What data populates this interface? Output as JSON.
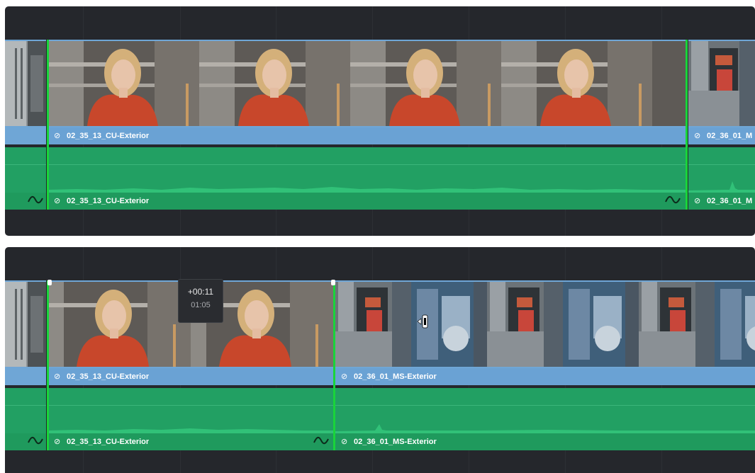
{
  "top_timeline": {
    "video_clips": [
      {
        "name": "prev-clip-video",
        "label": ""
      },
      {
        "name": "cu-exterior-video",
        "label": "02_35_13_CU-Exterior"
      },
      {
        "name": "ms-exterior-video",
        "label": "02_36_01_M"
      }
    ],
    "audio_clips": [
      {
        "name": "prev-clip-audio",
        "label": ""
      },
      {
        "name": "cu-exterior-audio",
        "label": "02_35_13_CU-Exterior"
      },
      {
        "name": "ms-exterior-audio",
        "label": "02_36_01_M"
      }
    ]
  },
  "bottom_timeline": {
    "video_clips": [
      {
        "name": "prev-clip-video",
        "label": ""
      },
      {
        "name": "cu-exterior-video",
        "label": "02_35_13_CU-Exterior"
      },
      {
        "name": "ms-exterior-video",
        "label": "02_36_01_MS-Exterior"
      }
    ],
    "audio_clips": [
      {
        "name": "prev-clip-audio",
        "label": ""
      },
      {
        "name": "cu-exterior-audio",
        "label": "02_35_13_CU-Exterior"
      },
      {
        "name": "ms-exterior-audio",
        "label": "02_36_01_MS-Exterior"
      }
    ],
    "trim_tooltip": {
      "offset": "+00:11",
      "duration": "01:05"
    }
  },
  "colors": {
    "timeline_bg": "#25272c",
    "video_clip": "#6fa6d6",
    "audio_clip": "#22a063",
    "edit_point": "#19d43a"
  },
  "icons": {
    "link": "link-icon",
    "fade": "fade-handle-icon",
    "trim_cursor": "ripple-trim-cursor-icon"
  }
}
